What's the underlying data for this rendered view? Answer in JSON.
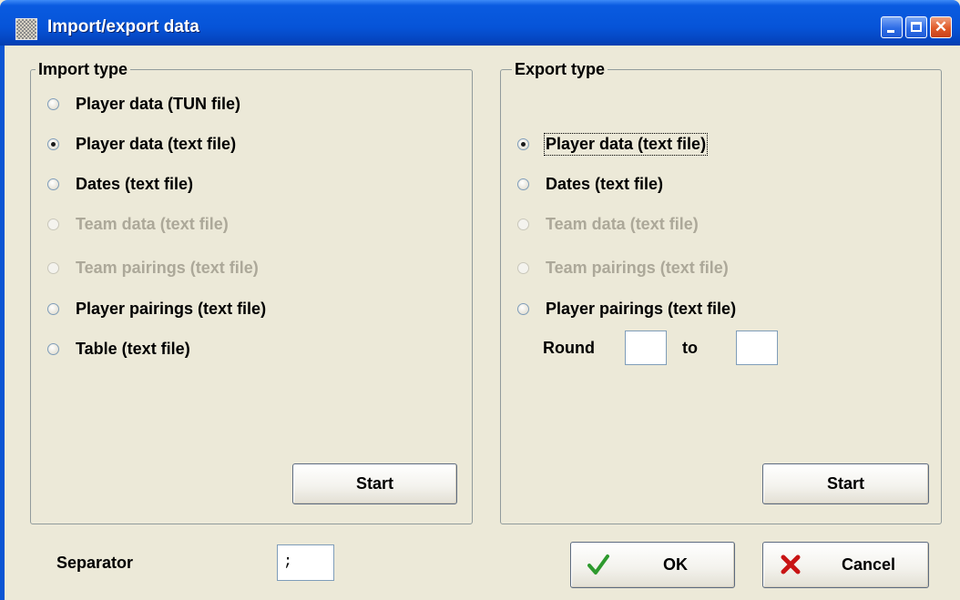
{
  "window": {
    "title": "Import/export data",
    "controls": {
      "minimize": "minimize-icon",
      "maximize": "maximize-icon",
      "close": "close-icon",
      "close_glyph": "✕"
    }
  },
  "import": {
    "legend": "Import type",
    "options": [
      {
        "label": "Player data (TUN file)",
        "checked": false,
        "enabled": true
      },
      {
        "label": "Player data (text file)",
        "checked": true,
        "enabled": true
      },
      {
        "label": "Dates (text file)",
        "checked": false,
        "enabled": true
      },
      {
        "label": "Team data (text file)",
        "checked": false,
        "enabled": false
      },
      {
        "label": "Team pairings (text file)",
        "checked": false,
        "enabled": false
      },
      {
        "label": "Player pairings (text file)",
        "checked": false,
        "enabled": true
      },
      {
        "label": "Table (text file)",
        "checked": false,
        "enabled": true
      }
    ],
    "start_label": "Start"
  },
  "export": {
    "legend": "Export type",
    "options": [
      {
        "label": "Player data (text file)",
        "checked": true,
        "enabled": true
      },
      {
        "label": "Dates (text file)",
        "checked": false,
        "enabled": true
      },
      {
        "label": "Team data (text file)",
        "checked": false,
        "enabled": false
      },
      {
        "label": "Team pairings (text file)",
        "checked": false,
        "enabled": false
      },
      {
        "label": "Player pairings (text file)",
        "checked": false,
        "enabled": true
      }
    ],
    "round_label": "Round",
    "to_label": "to",
    "round_from": "",
    "round_to": "",
    "start_label": "Start"
  },
  "footer": {
    "separator_label": "Separator",
    "separator_value": ";",
    "ok_label": "OK",
    "cancel_label": "Cancel"
  },
  "colors": {
    "titlebar": "#0654d8",
    "face": "#ece9d8",
    "disabled_text": "#aca899",
    "ok_check": "#2e9a2e",
    "cancel_x": "#c81414"
  }
}
